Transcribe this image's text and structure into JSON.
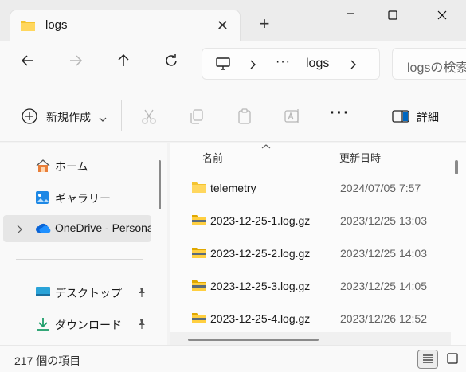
{
  "window": {
    "tab_title": "logs",
    "tab_close": "✕",
    "new_tab": "+"
  },
  "address": {
    "dots": "···",
    "current": "logs"
  },
  "search": {
    "placeholder": "logsの検索"
  },
  "commands": {
    "new_label": "新規作成",
    "more": "···",
    "details_label": "詳細"
  },
  "nav": {
    "items": [
      {
        "label": "ホーム",
        "icon": "home-icon"
      },
      {
        "label": "ギャラリー",
        "icon": "gallery-icon"
      },
      {
        "label": "OneDrive - Personal",
        "icon": "onedrive-icon"
      },
      {
        "label": "デスクトップ",
        "icon": "desktop-icon"
      },
      {
        "label": "ダウンロード",
        "icon": "download-icon"
      }
    ]
  },
  "columns": {
    "name": "名前",
    "date": "更新日時"
  },
  "files": [
    {
      "name": "telemetry",
      "date": "2024/07/05 7:57",
      "type": "folder"
    },
    {
      "name": "2023-12-25-1.log.gz",
      "date": "2023/12/25 13:03",
      "type": "gz"
    },
    {
      "name": "2023-12-25-2.log.gz",
      "date": "2023/12/25 14:03",
      "type": "gz"
    },
    {
      "name": "2023-12-25-3.log.gz",
      "date": "2023/12/25 14:05",
      "type": "gz"
    },
    {
      "name": "2023-12-25-4.log.gz",
      "date": "2023/12/26 12:52",
      "type": "gz"
    }
  ],
  "status": {
    "item_count": "217 個の項目"
  },
  "colors": {
    "folder": "#f4c430",
    "accent": "#0067c0",
    "selection": "#e6e6e6"
  }
}
